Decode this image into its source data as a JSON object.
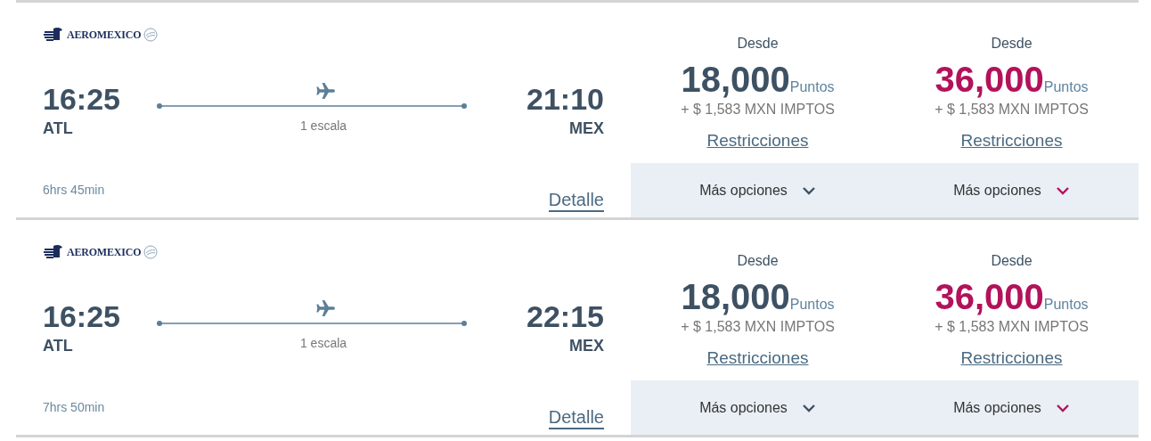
{
  "flights": [
    {
      "airline": "AEROMEXICO",
      "departure_time": "16:25",
      "origin": "ATL",
      "stops": "1 escala",
      "arrival_time": "21:10",
      "destination": "MEX",
      "duration": "6hrs 45min",
      "detail_link": "Detalle",
      "fares": [
        {
          "label": "Desde",
          "points": "18,000",
          "unit": "Puntos",
          "taxes": "+ $ 1,583 MXN IMPTOS",
          "restrictions": "Restricciones",
          "more": "Más opciones",
          "color": "#3d5163"
        },
        {
          "label": "Desde",
          "points": "36,000",
          "unit": "Puntos",
          "taxes": "+ $ 1,583 MXN IMPTOS",
          "restrictions": "Restricciones",
          "more": "Más opciones",
          "color": "#b3125a"
        }
      ]
    },
    {
      "airline": "AEROMEXICO",
      "departure_time": "16:25",
      "origin": "ATL",
      "stops": "1 escala",
      "arrival_time": "22:15",
      "destination": "MEX",
      "duration": "7hrs 50min",
      "detail_link": "Detalle",
      "fares": [
        {
          "label": "Desde",
          "points": "18,000",
          "unit": "Puntos",
          "taxes": "+ $ 1,583 MXN IMPTOS",
          "restrictions": "Restricciones",
          "more": "Más opciones",
          "color": "#3d5163"
        },
        {
          "label": "Desde",
          "points": "36,000",
          "unit": "Puntos",
          "taxes": "+ $ 1,583 MXN IMPTOS",
          "restrictions": "Restricciones",
          "more": "Más opciones",
          "color": "#b3125a"
        }
      ]
    }
  ]
}
